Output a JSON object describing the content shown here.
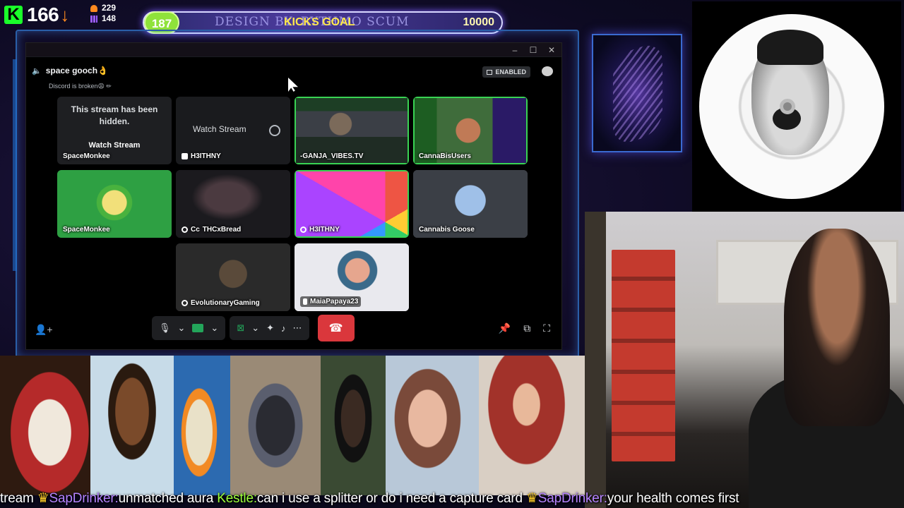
{
  "stream_overlay": {
    "kick_count": "166",
    "viewers_a": "229",
    "viewers_b": "148",
    "goal": {
      "current": "187",
      "design_credit": "DESIGN BY: RYTHMO SCUM",
      "label": "KICKS GOAL",
      "target": "10000",
      "progress_fraction": 0.0187
    }
  },
  "discord": {
    "window_controls": [
      "–",
      "☐",
      "✕"
    ],
    "channel_name": "space gooch👌",
    "status": "Discord is broken😩 ✏",
    "badge": "ENABLED",
    "tiles": [
      {
        "id": "t1",
        "hidden_msg_1": "This stream has been",
        "hidden_msg_2": "hidden.",
        "button": "Watch Stream",
        "name": "SpaceMonkee"
      },
      {
        "id": "t2",
        "button": "Watch Stream",
        "name": "H3ITHNY"
      },
      {
        "id": "t3",
        "name": "-GANJA_VIBES.TV"
      },
      {
        "id": "t4",
        "name": "CannaBisUsers"
      },
      {
        "id": "t5",
        "name": "SpaceMonkee"
      },
      {
        "id": "t6",
        "name": "THCxBread",
        "prefix": "Cc"
      },
      {
        "id": "t7",
        "name": "H3ITHNY"
      },
      {
        "id": "t8",
        "name": "Cannabis Goose"
      },
      {
        "id": "t9",
        "name": "EvolutionaryGaming"
      },
      {
        "id": "t10",
        "name": "MaiaPapaya23"
      }
    ]
  },
  "ticker": {
    "lead": "tream ",
    "msg1_user": "SapDrinker:",
    "msg1_text": "unmatched aura ",
    "msg2_user": "Kestle:",
    "msg2_text": "can i use a splitter or do i need a capture card ",
    "msg3_user": "SapDrinker:",
    "msg3_text": "your health comes first"
  },
  "colors": {
    "kick_green": "#1aff2a",
    "goal_green": "#8fe23a",
    "end_call_red": "#da373c",
    "discord_bg": "#000000"
  }
}
